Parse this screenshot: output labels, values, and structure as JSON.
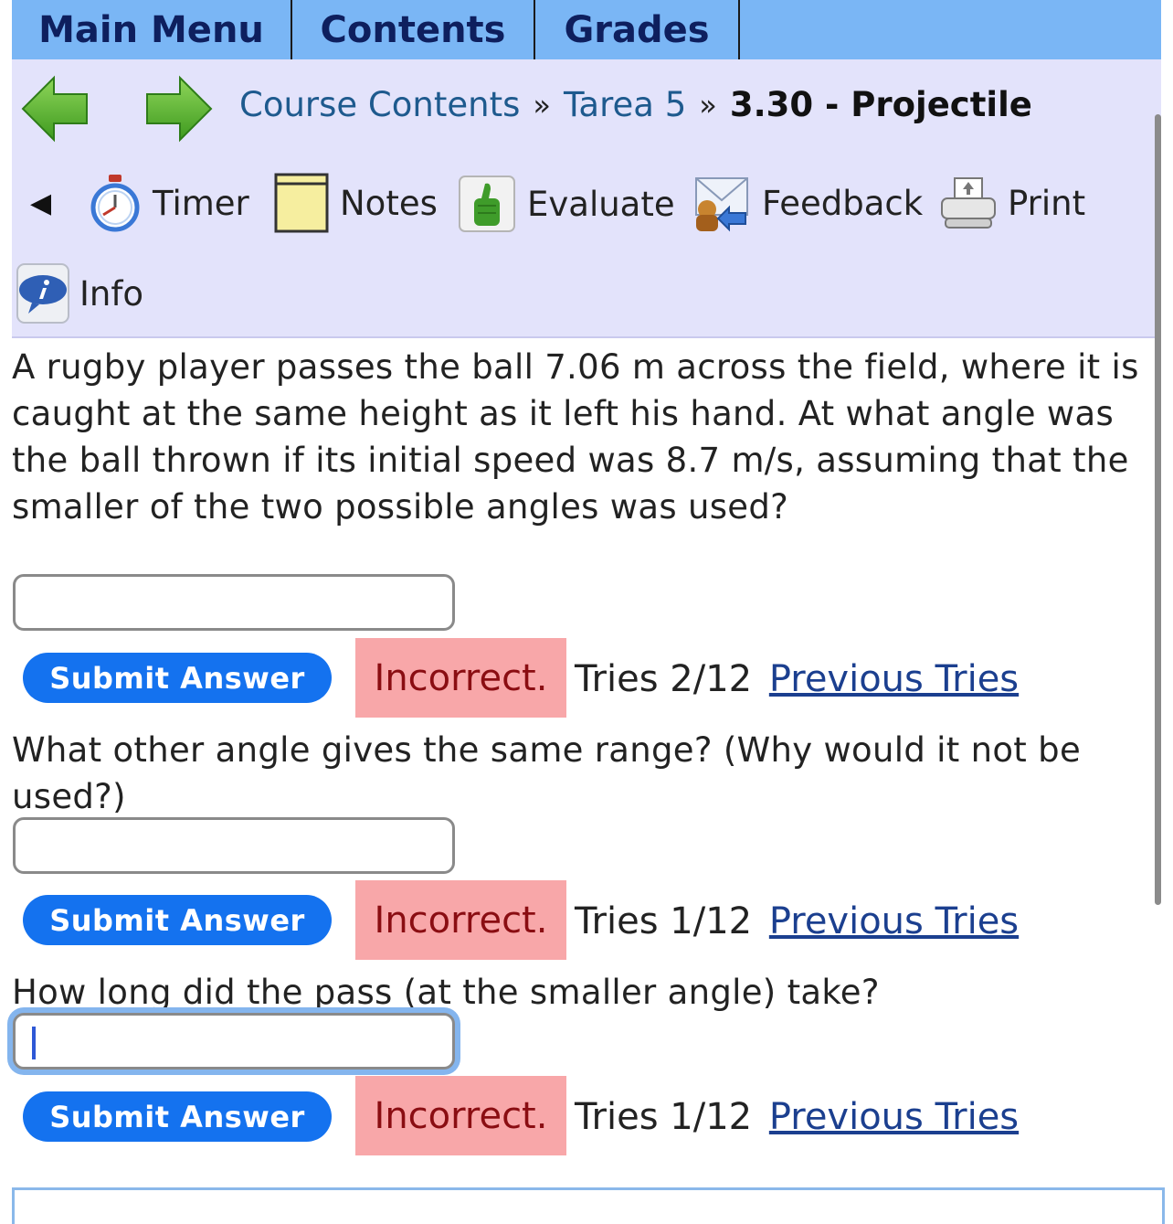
{
  "topnav": {
    "tabs": [
      "Main Menu",
      "Contents",
      "Grades"
    ]
  },
  "breadcrumb": {
    "course_contents": "Course Contents",
    "separator": "»",
    "tarea": "Tarea 5",
    "current": "3.30 - Projectile"
  },
  "toolbar": {
    "collapse": "◀",
    "timer": "Timer",
    "notes": "Notes",
    "evaluate": "Evaluate",
    "feedback": "Feedback",
    "print": "Print",
    "info": "Info"
  },
  "questions": [
    {
      "text": "A rugby player passes the ball 7.06 m across the field, where it is caught at the same height as it left his hand. At what angle was the ball thrown if its initial speed was 8.7 m/s, assuming that the smaller of the two possible angles was used?",
      "value": "",
      "submit": "Submit Answer",
      "status": "Incorrect.",
      "tries": "Tries 2/12",
      "previous": "Previous Tries"
    },
    {
      "text": "What other angle gives the same range? (Why would it not be used?)",
      "value": "",
      "submit": "Submit Answer",
      "status": "Incorrect.",
      "tries": "Tries 1/12",
      "previous": "Previous Tries"
    },
    {
      "text": "How long did the pass (at the smaller angle) take?",
      "value": "",
      "submit": "Submit Answer",
      "status": "Incorrect.",
      "tries": "Tries 1/12",
      "previous": "Previous Tries"
    }
  ],
  "colors": {
    "topbar": "#7ab6f5",
    "nav_panel": "#e3e3fb",
    "submit": "#1472ef",
    "incorrect_bg": "#f8a7a9",
    "incorrect_text": "#8a0d12",
    "link": "#1b3f8f"
  },
  "icons": [
    "back-arrow-icon",
    "forward-arrow-icon",
    "timer-icon",
    "notes-icon",
    "evaluate-icon",
    "feedback-icon",
    "print-icon",
    "info-icon"
  ]
}
